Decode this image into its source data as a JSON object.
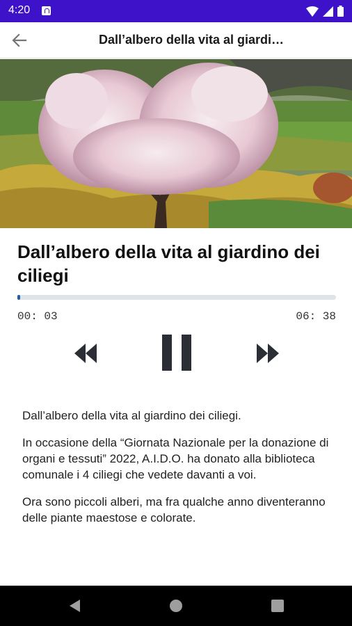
{
  "status_bar": {
    "time": "4:20"
  },
  "app_bar": {
    "title": "Dall’albero della vita al giardi…"
  },
  "player": {
    "title": "Dall’albero della vita al giardino dei ciliegi",
    "current_time": "00: 03",
    "total_time": "06: 38",
    "progress_fraction": 0.008
  },
  "description": {
    "paragraphs": [
      "Dall’albero della vita al giardino dei ciliegi.",
      "In occasione della  “Giornata Nazionale per la donazione di organi e tessuti” 2022, A.I.D.O.  ha donato alla biblioteca comunale i 4 ciliegi che vedete davanti a voi.",
      "Ora sono piccoli alberi, ma fra qualche anno diventeranno delle piante maestose e colorate."
    ]
  },
  "colors": {
    "status_bar": "#3d12c9",
    "progress_fill": "#1d5fa8",
    "progress_track": "#dfe4e8"
  }
}
